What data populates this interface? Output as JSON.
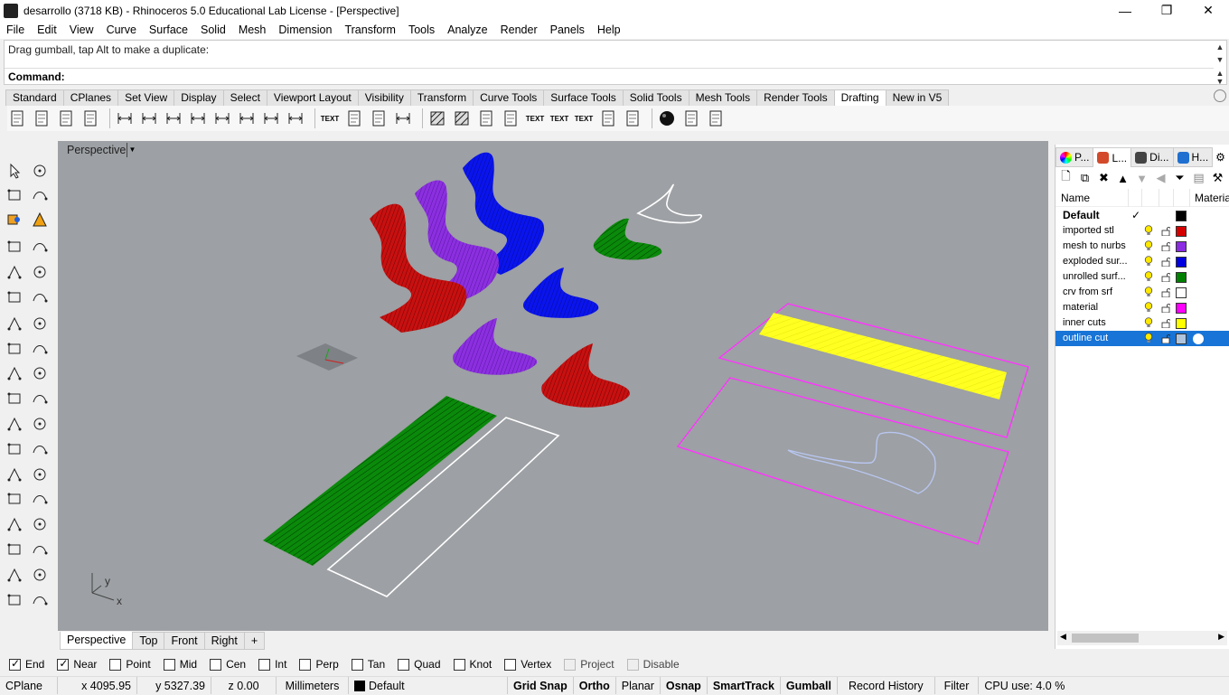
{
  "window": {
    "title": "desarrollo (3718 KB) - Rhinoceros 5.0 Educational Lab License - [Perspective]",
    "minimize": "—",
    "maximize": "❐",
    "close": "✕"
  },
  "menu": [
    "File",
    "Edit",
    "View",
    "Curve",
    "Surface",
    "Solid",
    "Mesh",
    "Dimension",
    "Transform",
    "Tools",
    "Analyze",
    "Render",
    "Panels",
    "Help"
  ],
  "command": {
    "history": "Drag gumball, tap Alt to make a duplicate:",
    "prompt": "Command:"
  },
  "toolbar_tabs": [
    "Standard",
    "CPlanes",
    "Set View",
    "Display",
    "Select",
    "Viewport Layout",
    "Visibility",
    "Transform",
    "Curve Tools",
    "Surface Tools",
    "Solid Tools",
    "Mesh Tools",
    "Render Tools",
    "Drafting",
    "New in V5"
  ],
  "active_toolbar_tab": "Drafting",
  "drafting_icons": [
    "grid-icon",
    "page-icon",
    "page-icon",
    "layout-icon",
    "dim-linear-icon",
    "dim-aligned-icon",
    "dim-rotated-icon",
    "dim-angle-icon",
    "dim-radius-icon",
    "dim-diameter-icon",
    "ordinate-x-icon",
    "ordinate-y-icon",
    "text-icon",
    "leader-icon",
    "balloon-icon",
    "dim-style-icon",
    "hatch-icon",
    "hatch-pattern-icon",
    "block-icon",
    "annotation-icon",
    "text-object-icon",
    "text-block-icon",
    "text-stack-icon",
    "make-2d-icon",
    "table-icon",
    "sphere-icon",
    "print-icon",
    "export-icon"
  ],
  "viewport": {
    "title": "Perspective",
    "axis_y": "y",
    "axis_x": "x"
  },
  "viewport_tabs": [
    "Perspective",
    "Top",
    "Front",
    "Right"
  ],
  "add_viewport_tab": "+",
  "panel": {
    "tabs": [
      {
        "label": "P...",
        "color": "#e0e0e0"
      },
      {
        "label": "L...",
        "color": "#d24a2a"
      },
      {
        "label": "Di...",
        "color": "#444444"
      },
      {
        "label": "H...",
        "color": "#1e6fd0"
      }
    ],
    "col_name": "Name",
    "col_material": "Material",
    "layers": [
      {
        "name": "Default",
        "color": "#000000",
        "current": true
      },
      {
        "name": "imported stl",
        "color": "#d40000"
      },
      {
        "name": "mesh to nurbs",
        "color": "#8b2be2"
      },
      {
        "name": "exploded sur...",
        "color": "#0000e0"
      },
      {
        "name": "unrolled surf...",
        "color": "#008000"
      },
      {
        "name": "crv from srf",
        "color": "#ffffff"
      },
      {
        "name": "material",
        "color": "#ff00ff"
      },
      {
        "name": "inner cuts",
        "color": "#ffff00"
      },
      {
        "name": "outline cut",
        "color": "#b0c4de",
        "selected": true
      }
    ],
    "current_mark": "✓"
  },
  "osnaps": [
    {
      "label": "End",
      "on": true
    },
    {
      "label": "Near",
      "on": true
    },
    {
      "label": "Point",
      "on": false
    },
    {
      "label": "Mid",
      "on": false
    },
    {
      "label": "Cen",
      "on": false
    },
    {
      "label": "Int",
      "on": false
    },
    {
      "label": "Perp",
      "on": false
    },
    {
      "label": "Tan",
      "on": false
    },
    {
      "label": "Quad",
      "on": false
    },
    {
      "label": "Knot",
      "on": false
    },
    {
      "label": "Vertex",
      "on": false
    },
    {
      "label": "Project",
      "on": false,
      "disabled": true
    },
    {
      "label": "Disable",
      "on": false,
      "disabled": true
    }
  ],
  "status": {
    "cplane": "CPlane",
    "x": "x 4095.95",
    "y": "y 5327.39",
    "z": "z 0.00",
    "units": "Millimeters",
    "layer": "Default",
    "grid_snap": "Grid Snap",
    "ortho": "Ortho",
    "planar": "Planar",
    "osnap": "Osnap",
    "smarttrack": "SmartTrack",
    "gumball": "Gumball",
    "record_history": "Record History",
    "filter": "Filter",
    "cpu": "CPU use: 4.0 %"
  },
  "colors": {
    "viewport_bg": "#9da0a4",
    "red": "#cc1010",
    "purple": "#8a2be2",
    "blue": "#0a0aee",
    "green": "#0a8a0a",
    "yellow": "#ffff20",
    "magenta": "#ff33ff",
    "selection": "#1874d6"
  }
}
